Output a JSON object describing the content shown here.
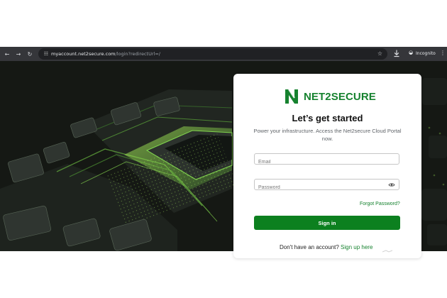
{
  "browser": {
    "url": {
      "host": "myaccount.net2secure.com",
      "path": "/login?redirectUrl=/"
    },
    "incognito_label": "Incognito",
    "icons": {
      "back": "back-arrow-icon",
      "forward": "forward-arrow-icon",
      "reload": "reload-icon",
      "site_info": "site-info-icon",
      "bookmark": "star-icon",
      "download": "download-icon",
      "incognito": "incognito-icon",
      "menu": "more-vertical-icon"
    },
    "colors": {
      "chrome": "#35363a",
      "address_bar": "#202124",
      "text": "#e8eaed"
    }
  },
  "login": {
    "logo_text": "NET2SECURE",
    "heading": "Let’s get started",
    "description": "Power your infrastructure. Access the Net2secure Cloud Portal now.",
    "email_placeholder": "Email",
    "password_placeholder": "Password",
    "forgot_password": "Forgot Password?",
    "sign_in": "Sign in",
    "signup_prompt": "Don't have an account?",
    "signup_link": "Sign up here",
    "icons": {
      "logo": "net2secure-logo-icon",
      "password_visibility": "eye-icon"
    },
    "colors": {
      "brand": "#16822f",
      "button": "#0c801f",
      "text": "#111111"
    }
  }
}
